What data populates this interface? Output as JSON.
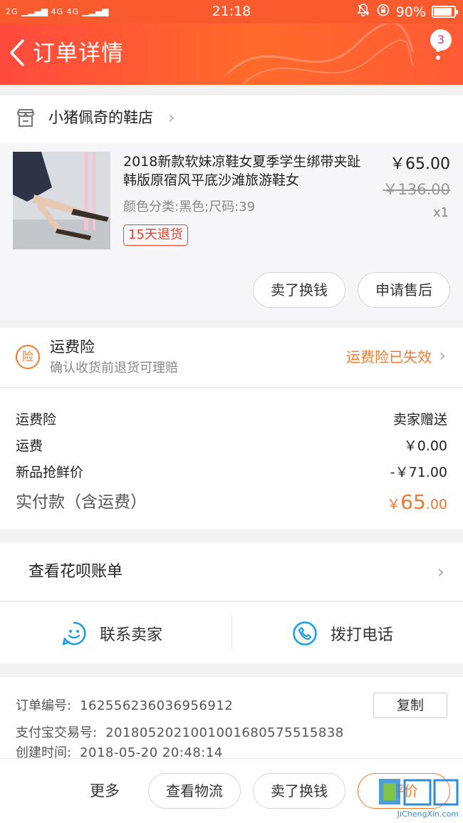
{
  "status_bar": {
    "network_left": "2G",
    "network_right": "4G 4G",
    "time": "21:18",
    "battery": "90%",
    "battery_level": 0.9
  },
  "header": {
    "title": "订单详情",
    "badge_count": "3",
    "back_icon": "chevron-left-icon",
    "more_icon": "vertical-dots-icon"
  },
  "shop": {
    "name": "小猪佩奇的鞋店"
  },
  "product": {
    "name": "2018新款软妹凉鞋女夏季学生绑带夹趾韩版原宿风平底沙滩旅游鞋女",
    "sku": "颜色分类:黑色;尺码:39",
    "return_tag": "15天退货",
    "price": "￥65.00",
    "original_price": "￥136.00",
    "quantity": "x1",
    "actions": [
      "卖了换钱",
      "申请售后"
    ]
  },
  "insurance": {
    "icon_text": "险",
    "title": "运费险",
    "subtitle": "确认收货前退货可理赔",
    "status": "运费险已失效"
  },
  "fees": {
    "rows": [
      {
        "label": "运费险",
        "value": "卖家赠送"
      },
      {
        "label": "运费",
        "value": "￥0.00"
      },
      {
        "label": "新品抢鲜价",
        "value": "-￥71.00"
      }
    ],
    "total_label": "实付款（含运费）",
    "total_currency": "￥",
    "total_integer": "65",
    "total_decimal": ".00"
  },
  "huabei": {
    "label": "查看花呗账单"
  },
  "contact": {
    "seller": "联系卖家",
    "phone": "拨打电话"
  },
  "order_info": {
    "order_no_label": "订单编号:",
    "order_no": "162556236036956912",
    "alipay_label": "支付宝交易号:",
    "alipay_no": "2018052021001001680575515838",
    "created_label": "创建时间:",
    "created_time": "2018-05-20 20:48:14",
    "copy_label": "复制"
  },
  "bottom_bar": {
    "more": "更多",
    "logistics": "查看物流",
    "sell": "卖了换钱",
    "review": "评价"
  },
  "watermark": {
    "text": "JiChengXin.com"
  },
  "colors": {
    "header": "#ff5a35",
    "accent_orange": "#f07a2e",
    "return_red": "#e8442c",
    "contact_blue": "#1aa0e6"
  }
}
